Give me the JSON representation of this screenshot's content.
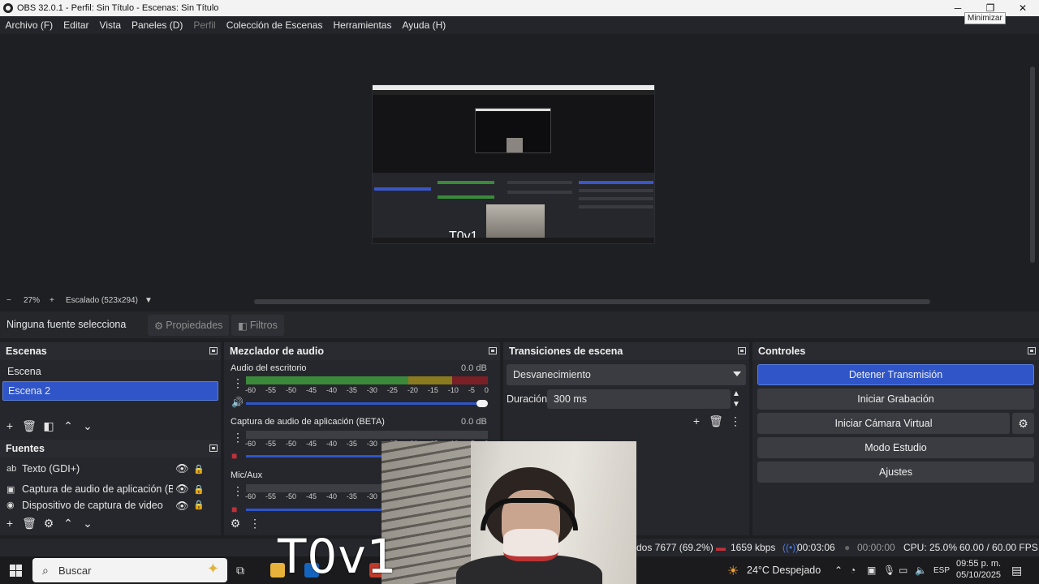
{
  "window": {
    "title": "OBS 32.0.1 - Perfil: Sin Título - Escenas: Sin Título",
    "tooltip": "Minimizar"
  },
  "menu": [
    "Archivo (F)",
    "Editar",
    "Vista",
    "Paneles (D)",
    "Perfil",
    "Colección de Escenas",
    "Herramientas",
    "Ayuda (H)"
  ],
  "preview": {
    "zoom": "27%",
    "scaling": "Escalado (523x294)",
    "embedded_text": "T0v1"
  },
  "properties_bar": {
    "no_selection": "Ninguna fuente selecciona",
    "properties": "Propiedades",
    "filters": "Filtros"
  },
  "scenes": {
    "title": "Escenas",
    "items": [
      "Escena",
      "Escena 2"
    ],
    "selected_index": 1
  },
  "sources": {
    "title": "Fuentes",
    "items": [
      {
        "label": "Texto (GDI+)",
        "icon": "text-icon"
      },
      {
        "label": "Captura de audio de aplicación (BETA",
        "icon": "app-audio-icon"
      },
      {
        "label": "Dispositivo de captura de video",
        "icon": "camera-icon"
      }
    ]
  },
  "mixer": {
    "title": "Mezclador de audio",
    "channels": [
      {
        "name": "Audio del escritorio",
        "db": "0.0 dB",
        "level": 0.97
      },
      {
        "name": "Captura de audio de aplicación (BETA)",
        "db": "0.0 dB",
        "level": 0
      },
      {
        "name": "Mic/Aux",
        "db": "",
        "level": 0
      }
    ],
    "ticks": [
      "-60",
      "-55",
      "-50",
      "-45",
      "-40",
      "-35",
      "-30",
      "-25",
      "-20",
      "-15",
      "-10",
      "-5",
      "0"
    ]
  },
  "transitions": {
    "title": "Transiciones de escena",
    "selected": "Desvanecimiento",
    "duration_label": "Duración",
    "duration_value": "300 ms"
  },
  "controls": {
    "title": "Controles",
    "stop_stream": "Detener Transmisión",
    "start_recording": "Iniciar Grabación",
    "start_virtual_cam": "Iniciar Cámara Virtual",
    "studio_mode": "Modo Estudio",
    "settings": "Ajustes"
  },
  "status": {
    "dropped": "dos 7677 (69.2%)",
    "bitrate": "1659 kbps",
    "stream_time": "00:03:06",
    "rec_time": "00:00:00",
    "cpu": "CPU: 25.0%",
    "fps": "60.00 / 60.00 FPS"
  },
  "taskbar": {
    "search_placeholder": "Buscar",
    "weather": "24°C  Despejado",
    "lang": "ESP",
    "time": "09:55 p. m.",
    "date": "05/10/2025"
  },
  "colors": {
    "accent": "#2f55c8",
    "panel": "#26272c",
    "background": "#1e1f22"
  }
}
